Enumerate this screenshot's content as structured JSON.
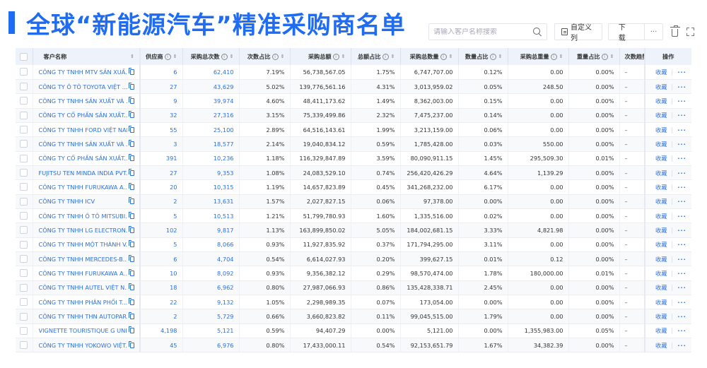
{
  "header": {
    "title": "全球“新能源汽车”精准采购商名单",
    "accent_color": "#1f6cf2"
  },
  "toolbar": {
    "search_placeholder": "请输入客户名称搜索",
    "search_value": "",
    "search_icon": "search-icon",
    "custom_columns_label": "自定义列",
    "custom_columns_icon": "columns-settings-icon",
    "download_label": "下 载",
    "more_label": "···",
    "trash_icon": "trash-icon",
    "expand_icon": "fullscreen-icon"
  },
  "table": {
    "columns": [
      {
        "key": "name",
        "label": "客户名称",
        "sortable": true,
        "info": false
      },
      {
        "key": "suppliers",
        "label": "供应商",
        "sortable": true,
        "info": true
      },
      {
        "key": "total_times",
        "label": "采购总次数",
        "sortable": true,
        "info": true
      },
      {
        "key": "times_ratio",
        "label": "次数占比",
        "sortable": true,
        "info": true
      },
      {
        "key": "total_amount",
        "label": "采购总额",
        "sortable": true,
        "info": true
      },
      {
        "key": "amount_ratio",
        "label": "总额占比",
        "sortable": true,
        "info": true
      },
      {
        "key": "total_qty",
        "label": "采购总数量",
        "sortable": true,
        "info": true
      },
      {
        "key": "qty_ratio",
        "label": "数量占比",
        "sortable": true,
        "info": true
      },
      {
        "key": "total_weight",
        "label": "采购总重量",
        "sortable": true,
        "info": true
      },
      {
        "key": "weight_ratio",
        "label": "重量占比",
        "sortable": true,
        "info": true
      },
      {
        "key": "times_trend",
        "label": "次数趋势",
        "sortable": false,
        "info": false
      },
      {
        "key": "actions",
        "label": "操作",
        "sortable": false,
        "info": false
      }
    ],
    "action_favorite": "收藏",
    "action_more": "···",
    "rows": [
      {
        "name": "CÔNG TY TNHH MTV SẢN XUẤ...",
        "suppliers": "6",
        "total_times": "62,410",
        "times_ratio": "7.19%",
        "total_amount": "56,738,567.05",
        "amount_ratio": "1.75%",
        "total_qty": "6,747,707.00",
        "qty_ratio": "0.12%",
        "total_weight": "0.00",
        "weight_ratio": "0.00%",
        "times_trend": "–"
      },
      {
        "name": "CÔNG TY Ô TÔ TOYOTA VIỆT ...",
        "suppliers": "27",
        "total_times": "43,629",
        "times_ratio": "5.02%",
        "total_amount": "139,776,561.16",
        "amount_ratio": "4.31%",
        "total_qty": "3,013,959.02",
        "qty_ratio": "0.05%",
        "total_weight": "248.50",
        "weight_ratio": "0.00%",
        "times_trend": "–"
      },
      {
        "name": "CÔNG TY TNHH SẢN XUẤT VÀ ...",
        "suppliers": "9",
        "total_times": "39,974",
        "times_ratio": "4.60%",
        "total_amount": "48,411,173.62",
        "amount_ratio": "1.49%",
        "total_qty": "8,362,003.00",
        "qty_ratio": "0.15%",
        "total_weight": "0.00",
        "weight_ratio": "0.00%",
        "times_trend": "–"
      },
      {
        "name": "CÔNG TY CỔ PHẦN SẢN XUẤT...",
        "suppliers": "32",
        "total_times": "27,316",
        "times_ratio": "3.15%",
        "total_amount": "75,339,499.86",
        "amount_ratio": "2.32%",
        "total_qty": "7,475,237.00",
        "qty_ratio": "0.14%",
        "total_weight": "0.00",
        "weight_ratio": "0.00%",
        "times_trend": "–"
      },
      {
        "name": "CÔNG TY TNHH FORD VIỆT NAM",
        "suppliers": "55",
        "total_times": "25,100",
        "times_ratio": "2.89%",
        "total_amount": "64,516,143.61",
        "amount_ratio": "1.99%",
        "total_qty": "3,213,159.00",
        "qty_ratio": "0.06%",
        "total_weight": "0.00",
        "weight_ratio": "0.00%",
        "times_trend": "–"
      },
      {
        "name": "CÔNG TY TNHH SẢN XUẤT VÀ ...",
        "suppliers": "3",
        "total_times": "18,577",
        "times_ratio": "2.14%",
        "total_amount": "19,040,834.12",
        "amount_ratio": "0.59%",
        "total_qty": "1,785,428.00",
        "qty_ratio": "0.03%",
        "total_weight": "550.00",
        "weight_ratio": "0.00%",
        "times_trend": "–"
      },
      {
        "name": "CÔNG TY CỔ PHẦN SẢN XUẤT...",
        "suppliers": "391",
        "total_times": "10,236",
        "times_ratio": "1.18%",
        "total_amount": "116,329,847.89",
        "amount_ratio": "3.59%",
        "total_qty": "80,090,911.15",
        "qty_ratio": "1.45%",
        "total_weight": "295,509.30",
        "weight_ratio": "0.01%",
        "times_trend": "–"
      },
      {
        "name": "FUJITSU TEN MINDA INDIA PVT...",
        "suppliers": "27",
        "total_times": "9,353",
        "times_ratio": "1.08%",
        "total_amount": "24,083,529.10",
        "amount_ratio": "0.74%",
        "total_qty": "256,420,426.29",
        "qty_ratio": "4.64%",
        "total_weight": "1,139.29",
        "weight_ratio": "0.00%",
        "times_trend": "–"
      },
      {
        "name": "CÔNG TY TNHH FURUKAWA A...",
        "suppliers": "20",
        "total_times": "10,315",
        "times_ratio": "1.19%",
        "total_amount": "14,657,823.89",
        "amount_ratio": "0.45%",
        "total_qty": "341,268,232.00",
        "qty_ratio": "6.17%",
        "total_weight": "0.00",
        "weight_ratio": "0.00%",
        "times_trend": "–"
      },
      {
        "name": "CÔNG TY TNHH ICV",
        "suppliers": "2",
        "total_times": "13,631",
        "times_ratio": "1.57%",
        "total_amount": "2,027,827.15",
        "amount_ratio": "0.06%",
        "total_qty": "97,378.00",
        "qty_ratio": "0.00%",
        "total_weight": "0.00",
        "weight_ratio": "0.00%",
        "times_trend": "–"
      },
      {
        "name": "CÔNG TY TNHH Ô TÔ MITSUBI...",
        "suppliers": "5",
        "total_times": "10,513",
        "times_ratio": "1.21%",
        "total_amount": "51,799,780.93",
        "amount_ratio": "1.60%",
        "total_qty": "1,335,516.00",
        "qty_ratio": "0.02%",
        "total_weight": "0.00",
        "weight_ratio": "0.00%",
        "times_trend": "–"
      },
      {
        "name": "CÔNG TY TNHH LG ELECTRON...",
        "suppliers": "102",
        "total_times": "9,817",
        "times_ratio": "1.13%",
        "total_amount": "163,899,850.02",
        "amount_ratio": "5.05%",
        "total_qty": "184,002,681.15",
        "qty_ratio": "3.33%",
        "total_weight": "4,821.98",
        "weight_ratio": "0.00%",
        "times_trend": "–"
      },
      {
        "name": "CÔNG TY TNHH MỘT THÀNH V...",
        "suppliers": "5",
        "total_times": "8,066",
        "times_ratio": "0.93%",
        "total_amount": "11,927,835.92",
        "amount_ratio": "0.37%",
        "total_qty": "171,794,295.00",
        "qty_ratio": "3.11%",
        "total_weight": "0.00",
        "weight_ratio": "0.00%",
        "times_trend": "–"
      },
      {
        "name": "CÔNG TY TNHH MERCEDES-B...",
        "suppliers": "6",
        "total_times": "4,704",
        "times_ratio": "0.54%",
        "total_amount": "6,614,027.93",
        "amount_ratio": "0.20%",
        "total_qty": "399,627.15",
        "qty_ratio": "0.01%",
        "total_weight": "0.12",
        "weight_ratio": "0.00%",
        "times_trend": "–"
      },
      {
        "name": "CÔNG TY TNHH FURUKAWA A...",
        "suppliers": "10",
        "total_times": "8,092",
        "times_ratio": "0.93%",
        "total_amount": "9,356,382.12",
        "amount_ratio": "0.29%",
        "total_qty": "98,570,474.00",
        "qty_ratio": "1.78%",
        "total_weight": "180,000.00",
        "weight_ratio": "0.01%",
        "times_trend": "–"
      },
      {
        "name": "CÔNG TY TNHH AUTEL VIỆT N...",
        "suppliers": "18",
        "total_times": "6,962",
        "times_ratio": "0.80%",
        "total_amount": "27,987,066.93",
        "amount_ratio": "0.86%",
        "total_qty": "135,428,338.71",
        "qty_ratio": "2.45%",
        "total_weight": "0.00",
        "weight_ratio": "0.00%",
        "times_trend": "–"
      },
      {
        "name": "CÔNG TY TNHH PHÂN PHỐI T...",
        "suppliers": "22",
        "total_times": "9,132",
        "times_ratio": "1.05%",
        "total_amount": "2,298,989.35",
        "amount_ratio": "0.07%",
        "total_qty": "173,054.00",
        "qty_ratio": "0.00%",
        "total_weight": "0.00",
        "weight_ratio": "0.00%",
        "times_trend": "–"
      },
      {
        "name": "CÔNG TY TNHH THN AUTOPAR...",
        "suppliers": "2",
        "total_times": "5,729",
        "times_ratio": "0.66%",
        "total_amount": "3,660,823.82",
        "amount_ratio": "0.11%",
        "total_qty": "99,045,515.00",
        "qty_ratio": "1.79%",
        "total_weight": "0.00",
        "weight_ratio": "0.00%",
        "times_trend": "–"
      },
      {
        "name": "VIGNETTE TOURISTIQUE G UNI...",
        "suppliers": "4,198",
        "total_times": "5,121",
        "times_ratio": "0.59%",
        "total_amount": "94,407.29",
        "amount_ratio": "0.00%",
        "total_qty": "5,121.00",
        "qty_ratio": "0.00%",
        "total_weight": "1,355,983.00",
        "weight_ratio": "0.05%",
        "times_trend": "–"
      },
      {
        "name": "CÔNG TY TNHH YOKOWO VIỆT...",
        "suppliers": "45",
        "total_times": "6,976",
        "times_ratio": "0.80%",
        "total_amount": "17,433,000.11",
        "amount_ratio": "0.54%",
        "total_qty": "92,153,651.79",
        "qty_ratio": "1.67%",
        "total_weight": "34,382.39",
        "weight_ratio": "0.00%",
        "times_trend": "–"
      }
    ]
  }
}
